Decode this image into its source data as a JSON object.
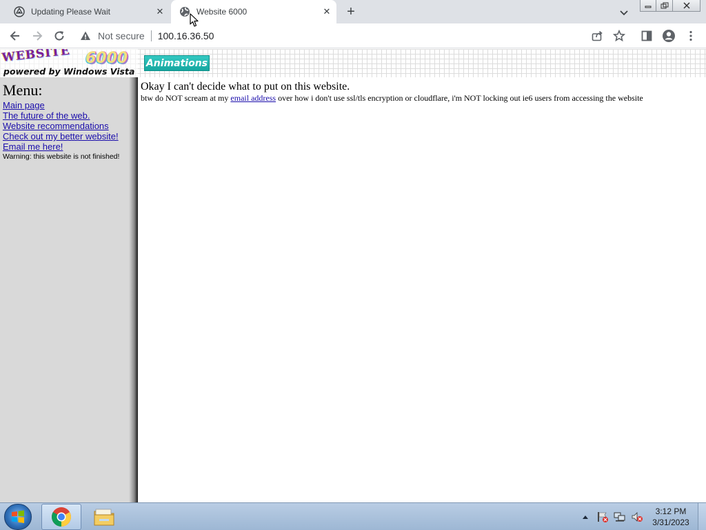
{
  "browser": {
    "tabs": [
      {
        "title": "Updating Please Wait",
        "icon": "floppy-icon",
        "active": false
      },
      {
        "title": "Website 6000",
        "icon": "globe-icon",
        "active": true
      }
    ],
    "new_tab": "+",
    "omnibox": {
      "security_label": "Not secure",
      "url": "100.16.36.50"
    }
  },
  "site": {
    "logo_word": "WEBSITE",
    "logo_number": "6000",
    "logo_tagline": "powered by Windows Vista",
    "animations_button": "Animations",
    "menu": {
      "title": "Menu:",
      "links": [
        "Main page",
        "The future of the web.",
        "Website recommendations",
        "Check out my better website!",
        "Email me here!"
      ],
      "warning": "Warning: this website is not finished!"
    },
    "main": {
      "heading": "Okay I can't decide what to put on this website.",
      "sub_before": "btw do NOT scream at my ",
      "sub_link": "email address",
      "sub_after": " over how i don't use ssl/tls encryption or cloudflare, i'm NOT locking out ie6 users from accessing the website"
    }
  },
  "taskbar": {
    "clock_time": "3:12 PM",
    "clock_date": "3/31/2023",
    "apps": [
      "chrome-icon",
      "file-explorer-icon"
    ]
  },
  "colors": {
    "tab_strip": "#dee1e6",
    "sidebar": "#d9d9d9",
    "link": "#1a0dab",
    "animations_button": "#16a7a0",
    "taskbar": "#b9cde4"
  }
}
